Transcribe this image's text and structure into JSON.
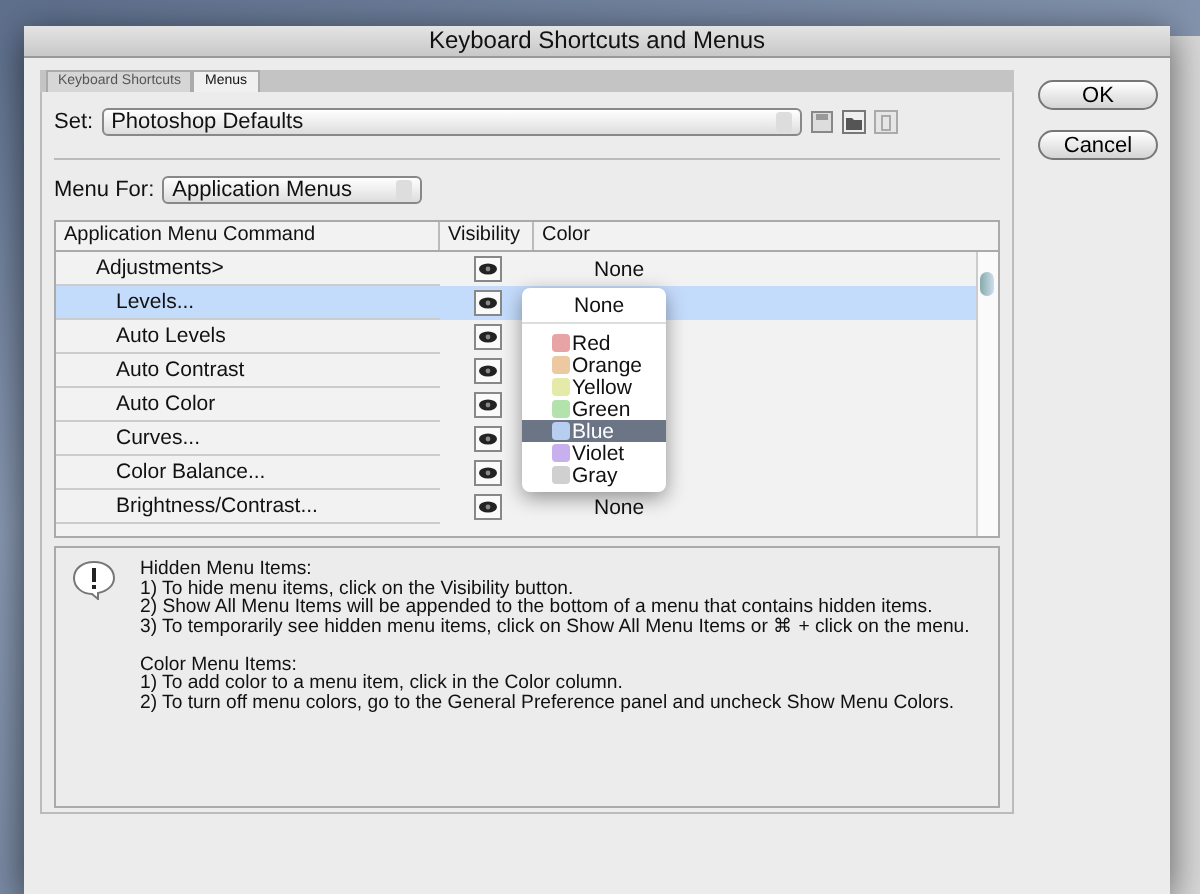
{
  "window": {
    "title": "Keyboard Shortcuts and Menus"
  },
  "tabs": [
    {
      "label": "Keyboard Shortcuts",
      "selected": false
    },
    {
      "label": "Menus",
      "selected": true
    }
  ],
  "set": {
    "label": "Set:",
    "value": "Photoshop Defaults"
  },
  "menu_for": {
    "label": "Menu For:",
    "value": "Application Menus"
  },
  "table": {
    "columns": [
      "Application Menu Command",
      "Visibility",
      "Color"
    ],
    "rows": [
      {
        "label": "Adjustments>",
        "visible": true,
        "selected": false,
        "color_label": "None",
        "children": [
          {
            "label": "Levels...",
            "visible": true,
            "selected": true
          },
          {
            "label": "Auto Levels",
            "visible": true,
            "selected": false
          },
          {
            "label": "Auto Contrast",
            "visible": true,
            "selected": false
          },
          {
            "label": "Auto Color",
            "visible": true,
            "selected": false
          },
          {
            "label": "Curves...",
            "visible": true,
            "selected": false
          },
          {
            "label": "Color Balance...",
            "visible": true,
            "selected": false
          },
          {
            "label": "Brightness/Contrast...",
            "visible": true,
            "selected": false,
            "color_label": "None"
          }
        ]
      }
    ]
  },
  "color_popup": {
    "items": [
      {
        "label": "None",
        "selected": false
      },
      {
        "label": "Red",
        "color": "#e8a4a4",
        "selected": false
      },
      {
        "label": "Orange",
        "color": "#ecc9a0",
        "selected": false
      },
      {
        "label": "Yellow",
        "color": "#e6eaa8",
        "selected": false
      },
      {
        "label": "Green",
        "color": "#b4e2ac",
        "selected": false
      },
      {
        "label": "Blue",
        "color": "#b8cef0",
        "selected": true
      },
      {
        "label": "Violet",
        "color": "#c8b0ee",
        "selected": false
      },
      {
        "label": "Gray",
        "color": "#d0d0d0",
        "selected": false
      }
    ]
  },
  "info": {
    "sections": [
      {
        "title": "Hidden Menu Items:",
        "lines": [
          "1) To hide menu items, click on the Visibility button.",
          "2) Show All Menu Items will be appended to the bottom of a menu that contains hidden items.",
          "3) To temporarily see hidden menu items, click on Show All Menu Items or ⌘ + click on the menu."
        ]
      },
      {
        "title": "Color Menu Items:",
        "lines": [
          "1) To add color to a menu item, click in the Color column.",
          "2) To turn off menu colors, go to the General Preference panel and uncheck Show Menu Colors."
        ]
      }
    ]
  },
  "buttons": [
    "OK",
    "Cancel"
  ]
}
